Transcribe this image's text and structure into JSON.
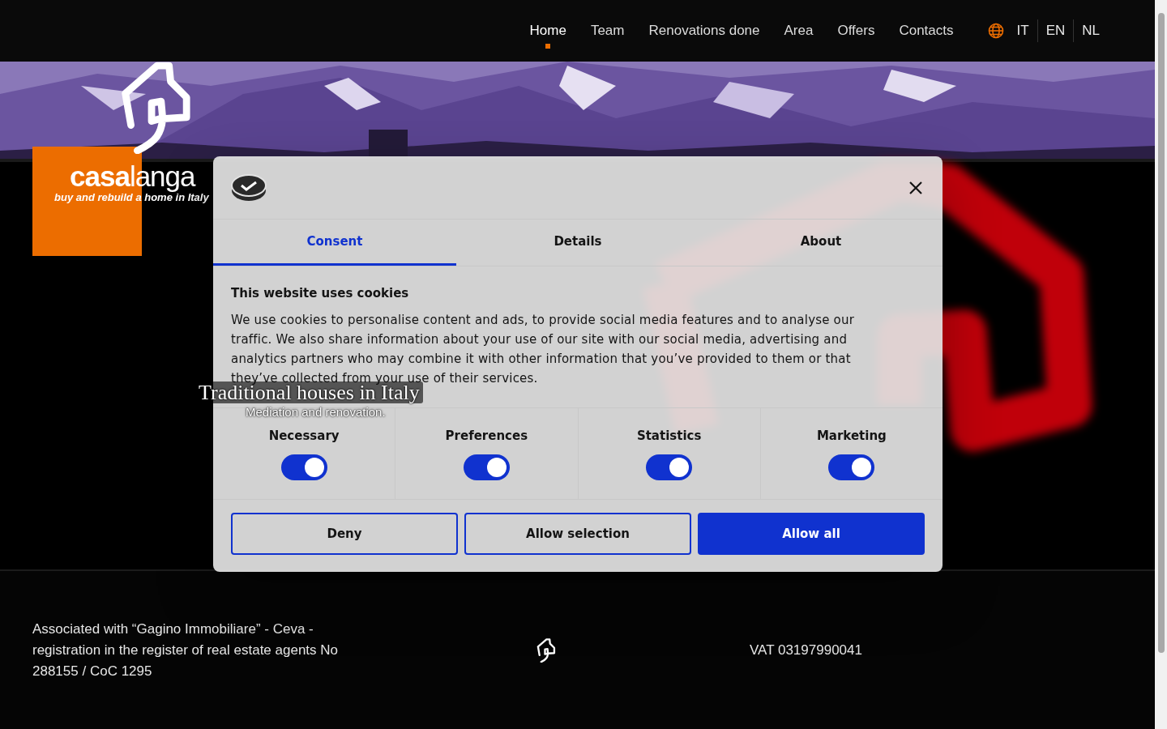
{
  "nav": {
    "items": [
      {
        "label": "Home",
        "selected": true
      },
      {
        "label": "Team",
        "selected": false
      },
      {
        "label": "Renovations done",
        "selected": false
      },
      {
        "label": "Area",
        "selected": false
      },
      {
        "label": "Offers",
        "selected": false
      },
      {
        "label": "Contacts",
        "selected": false
      }
    ],
    "languages": [
      "IT",
      "EN",
      "NL"
    ]
  },
  "logo": {
    "brand_bold": "casa",
    "brand_light": "langa",
    "tagline": "buy and rebuild a home in Italy"
  },
  "hero": {
    "title": "Traditional houses in Italy",
    "subtitle": "Mediation and renovation."
  },
  "cookie_dialog": {
    "tabs": [
      {
        "label": "Consent",
        "selected": true
      },
      {
        "label": "Details",
        "selected": false
      },
      {
        "label": "About",
        "selected": false
      }
    ],
    "title": "This website uses cookies",
    "text": "We use cookies to personalise content and ads, to provide social media features and to analyse our traffic. We also share information about your use of our site with our social media, advertising and analytics partners who may combine it with other information that you’ve provided to them or that they’ve collected from your use of their services.",
    "categories": [
      {
        "label": "Necessary",
        "on": true
      },
      {
        "label": "Preferences",
        "on": true
      },
      {
        "label": "Statistics",
        "on": true
      },
      {
        "label": "Marketing",
        "on": true
      }
    ],
    "buttons": [
      {
        "label": "Deny",
        "kind": "outline"
      },
      {
        "label": "Allow selection",
        "kind": "outline"
      },
      {
        "label": "Allow all",
        "kind": "primary"
      }
    ]
  },
  "footer": {
    "association": "Associated with “Gagino Immobiliare” - Ceva - registration in the register of real estate agents No 288155 / CoC 1295",
    "vat": "VAT 03197990041"
  }
}
